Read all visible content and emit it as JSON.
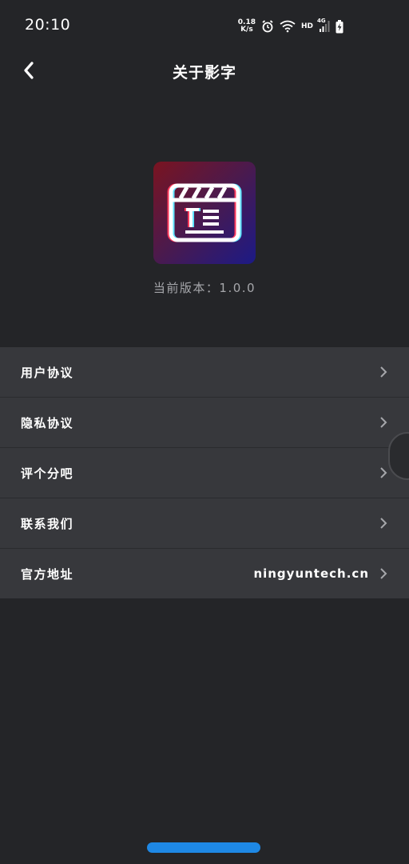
{
  "status_bar": {
    "time": "20:10",
    "net_speed_value": "0.18",
    "net_speed_unit": "K/s",
    "hd_label": "HD",
    "network_type": "4G"
  },
  "header": {
    "title": "关于影字"
  },
  "about": {
    "version_text": "当前版本：1.0.0"
  },
  "menu": {
    "items": [
      {
        "label": "用户协议",
        "value": ""
      },
      {
        "label": "隐私协议",
        "value": ""
      },
      {
        "label": "评个分吧",
        "value": ""
      },
      {
        "label": "联系我们",
        "value": ""
      },
      {
        "label": "官方地址",
        "value": "ningyuntech.cn"
      }
    ]
  },
  "icons": {
    "back": "back-arrow-icon",
    "chevron": "chevron-right-icon",
    "alarm": "alarm-icon",
    "wifi": "wifi-icon",
    "signal": "signal-icon",
    "battery": "battery-charging-icon"
  },
  "colors": {
    "background": "#242528",
    "menu_background": "#37383c",
    "secondary_text": "#a6a7ab",
    "accent_bar": "#1e88e5"
  }
}
